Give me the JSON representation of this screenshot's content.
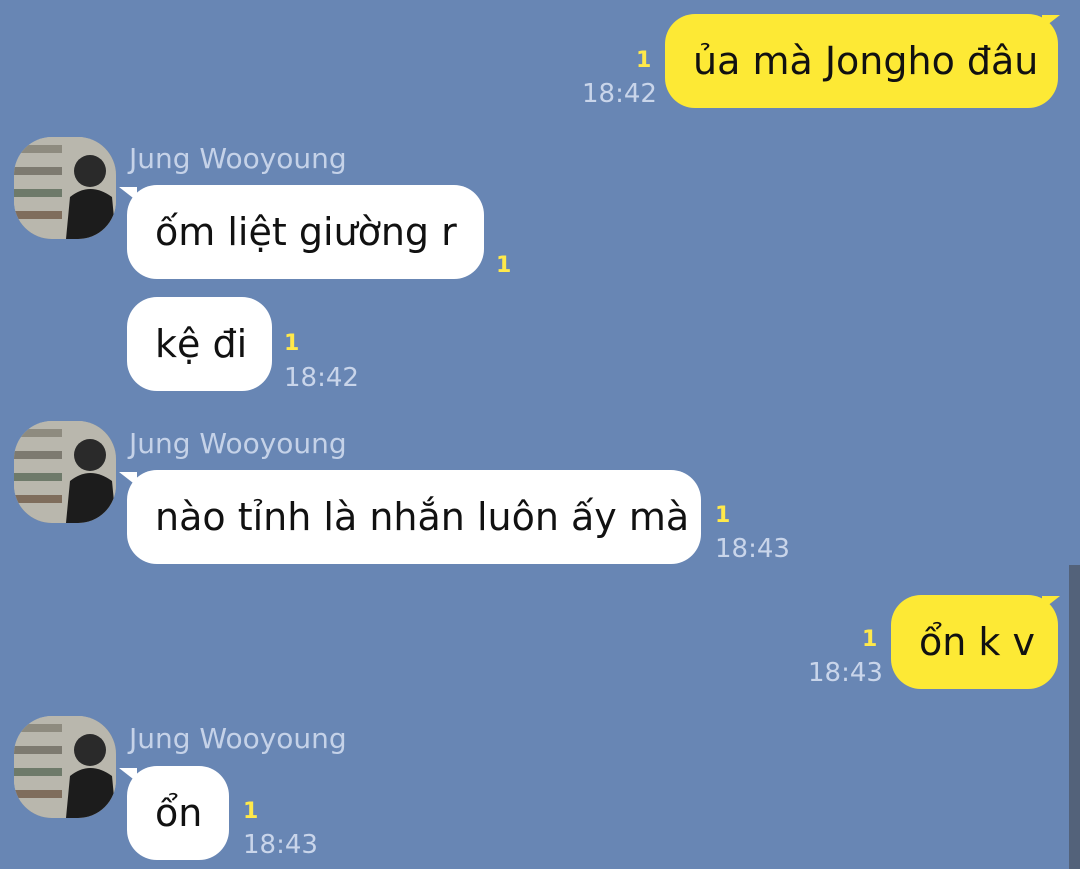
{
  "chat": {
    "messages": [
      {
        "id": "m1",
        "side": "outgoing",
        "text": "ủa mà Jongho đâu",
        "unread": "1",
        "time": "18:42"
      },
      {
        "id": "m2",
        "side": "incoming",
        "sender": "Jung Wooyoung",
        "text": "ốm liệt giường r",
        "unread": "1",
        "time": ""
      },
      {
        "id": "m3",
        "side": "incoming",
        "text": "kệ đi",
        "unread": "1",
        "time": "18:42"
      },
      {
        "id": "m4",
        "side": "incoming",
        "sender": "Jung Wooyoung",
        "text": "nào tỉnh là nhắn luôn ấy mà",
        "unread": "1",
        "time": "18:43"
      },
      {
        "id": "m5",
        "side": "outgoing",
        "text": "ổn k v",
        "unread": "1",
        "time": "18:43"
      },
      {
        "id": "m6",
        "side": "incoming",
        "sender": "Jung Wooyoung",
        "text": "ổn",
        "unread": "1",
        "time": "18:43"
      }
    ]
  },
  "theme": {
    "background": "#6886b4",
    "outgoing_bubble": "#fde935",
    "incoming_bubble": "#ffffff",
    "unread_color": "#ffe94a",
    "time_color": "#c9d5ea",
    "sender_color": "#c5d2e8"
  },
  "icons": {
    "avatar": "profile-photo"
  }
}
